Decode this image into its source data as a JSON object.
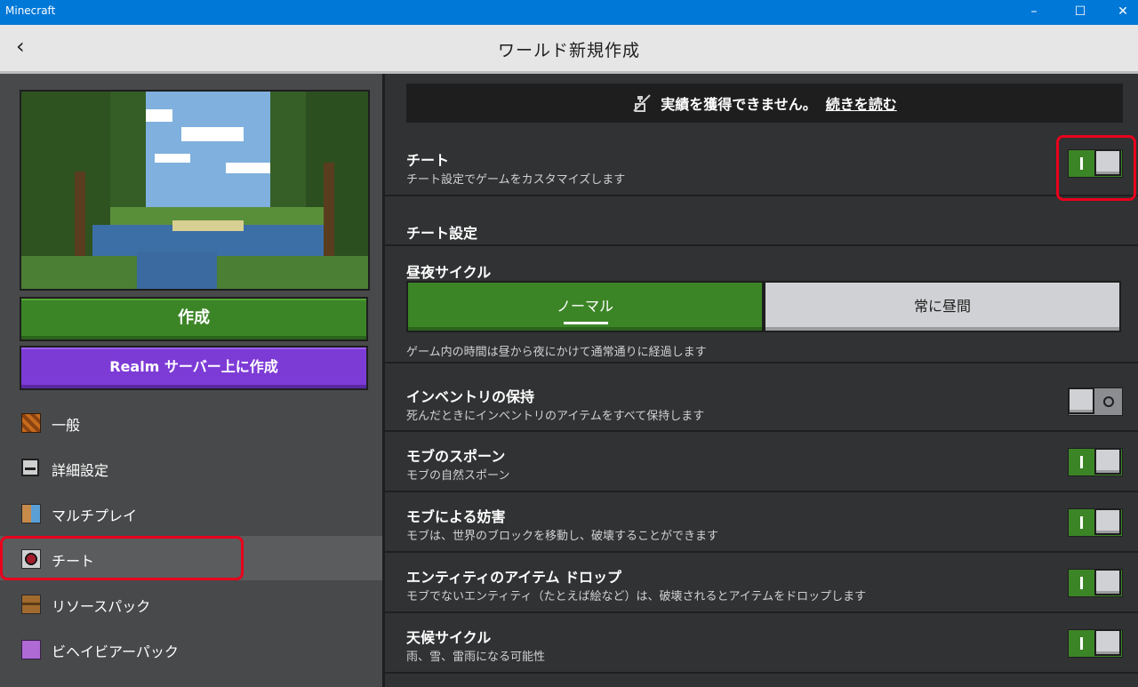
{
  "window": {
    "app_title": "Minecraft",
    "min_glyph": "–",
    "max_glyph": "☐",
    "close_glyph": "✕"
  },
  "header": {
    "back_glyph": "‹",
    "title": "ワールド新規作成"
  },
  "left": {
    "create_label": "作成",
    "realm_label": "Realm サーバー上に作成",
    "nav": [
      {
        "label": "一般",
        "icon": "gear-block-icon"
      },
      {
        "label": "詳細設定",
        "icon": "monitor-icon"
      },
      {
        "label": "マルチプレイ",
        "icon": "players-icon"
      },
      {
        "label": "チート",
        "icon": "command-block-icon",
        "selected": true
      },
      {
        "label": "リソースパック",
        "icon": "chest-icon"
      },
      {
        "label": "ビヘイビアーパック",
        "icon": "purple-block-icon"
      }
    ]
  },
  "banner": {
    "text": "実績を獲得できません。",
    "link": "続きを読む"
  },
  "settings": {
    "cheats": {
      "title": "チート",
      "desc": "チート設定でゲームをカスタマイズします",
      "on": true
    },
    "cheat_section": "チート設定",
    "daylight": {
      "title": "昼夜サイクル",
      "options": [
        "ノーマル",
        "常に昼間"
      ],
      "selected": "ノーマル",
      "desc": "ゲーム内の時間は昼から夜にかけて通常通りに経過します"
    },
    "keep_inventory": {
      "title": "インベントリの保持",
      "desc": "死んだときにインベントリのアイテムをすべて保持します",
      "on": false
    },
    "mob_spawning": {
      "title": "モブのスポーン",
      "desc": "モブの自然スポーン",
      "on": true
    },
    "mob_griefing": {
      "title": "モブによる妨害",
      "desc": "モブは、世界のブロックを移動し、破壊することができます",
      "on": true
    },
    "entity_drops": {
      "title": "エンティティのアイテム ドロップ",
      "desc": "モブでないエンティティ（たとえば絵など）は、破壊されるとアイテムをドロップします",
      "on": true
    },
    "weather_cycle": {
      "title": "天候サイクル",
      "desc": "雨、雪、雷雨になる可能性",
      "on": true
    }
  },
  "colors": {
    "accent_green": "#3c8527",
    "realm_purple": "#7d3bd6",
    "highlight_red": "#e8001c",
    "titlebar_blue": "#0078d7"
  }
}
